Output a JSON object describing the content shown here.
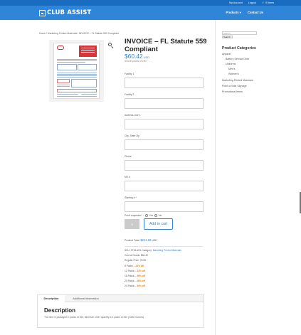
{
  "topbar": {
    "account": "My Account",
    "logout": "Logout",
    "cart": "0 Items"
  },
  "header": {
    "logo": "CLUB ASSIST",
    "nav": [
      "Products",
      "Contact Us"
    ],
    "products_arrow": "▾"
  },
  "breadcrumb": "Home / Marketing Printed Materials / INVOICE – FL Statute 559 Compliant",
  "product": {
    "title": "INVOICE – FL Statute 559 Compliant",
    "price": "$60.42",
    "currency": "USD",
    "subtitle": "Sold in packs of 250"
  },
  "fields": [
    {
      "label": "Facility 1",
      "value": ""
    },
    {
      "label": "Facility 2",
      "value": ""
    },
    {
      "label": "Address Line 1",
      "value": ""
    },
    {
      "label": "City, State Zip",
      "value": ""
    },
    {
      "label": "Phone",
      "value": ""
    },
    {
      "label": "MV #",
      "value": ""
    },
    {
      "label": "Starting #",
      "required": "*",
      "value": ""
    }
  ],
  "proof": {
    "label": "Proof requested",
    "required": "*",
    "yes": "Yes",
    "no": "No"
  },
  "cart": {
    "qty": "4",
    "add_label": "Add to cart"
  },
  "total": {
    "label": "Product Total:",
    "amount": "$241.68",
    "currency": "USD"
  },
  "meta": {
    "sku_label": "SKU:",
    "sku_value": "2715-AOL",
    "category_label": "Category:",
    "category_value": "Marketing Printed Materials",
    "cost_label": "Cost of Goods:",
    "cost_value": "$60.42",
    "regular_label": "Regular Price:",
    "regular_value": "78.95"
  },
  "discounts": [
    {
      "label": "8 Packs – ",
      "value": "24% off"
    },
    {
      "label": "12 Packs – ",
      "value": "32% off"
    },
    {
      "label": "16 Packs – ",
      "value": "36% off"
    },
    {
      "label": "20 Packs – ",
      "value": "38% off"
    },
    {
      "label": "24 Packs – ",
      "value": "40% off"
    }
  ],
  "tabs": [
    "Description",
    "Additional information"
  ],
  "description": {
    "heading": "Description",
    "text": "This item is packaged in packs of 250. Minimum order quantity is 4 packs of 250 (1000 invoices)."
  },
  "sidebar": {
    "search_placeholder": "Search",
    "search_button": "Search",
    "categories_title": "Product Categories",
    "categories": [
      "Apparel",
      "Battery Service Gear",
      "Uniforms",
      "Men's",
      "Women's",
      "Marketing Printed Materials",
      "Point of Sale Signage",
      "Promotional Items"
    ]
  },
  "colors": {
    "brand_blue": "#2f86d8",
    "topbar_blue": "#1a6cc0",
    "discount_orange": "#f57c00"
  }
}
